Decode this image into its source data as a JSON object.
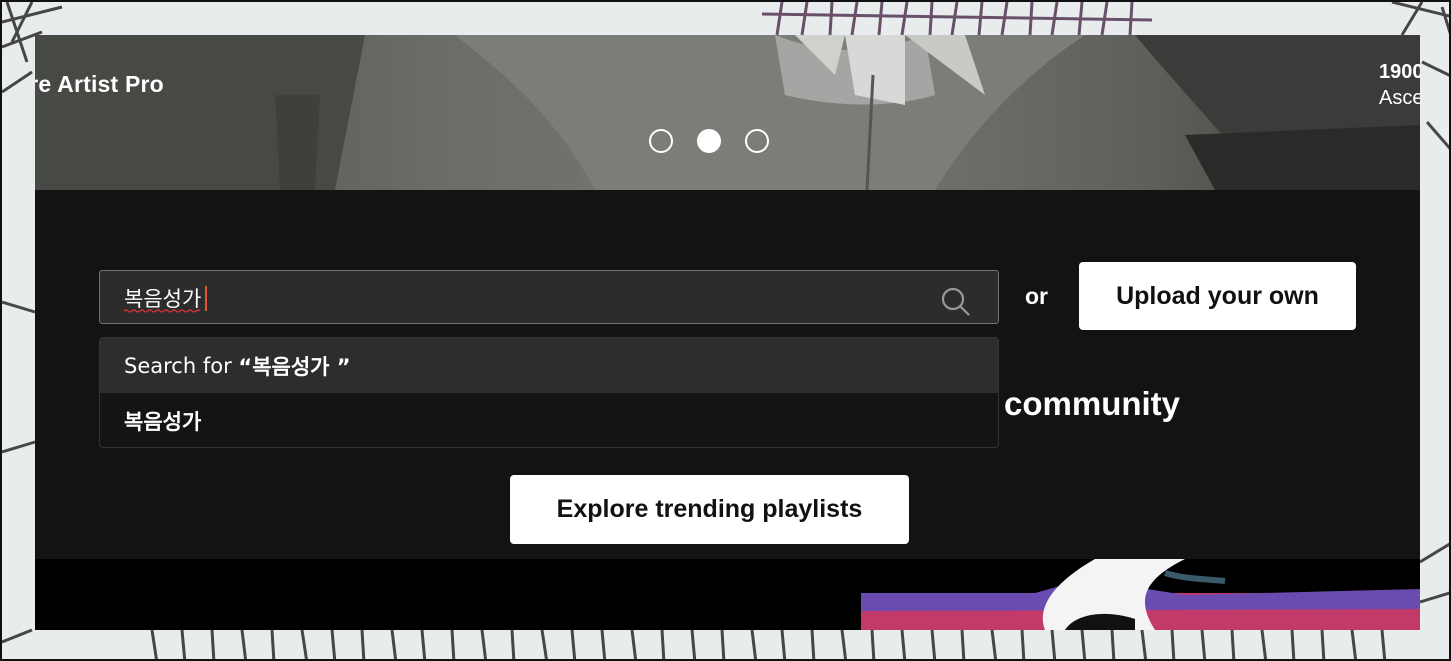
{
  "hero": {
    "title": "ore Artist Pro",
    "side_line1": "1900",
    "side_line2": "Asce",
    "carousel_dots": [
      {
        "active": false
      },
      {
        "active": true
      },
      {
        "active": false
      }
    ]
  },
  "search": {
    "value": "복음성가",
    "icon": "search-icon"
  },
  "or_label": "or",
  "upload_label": "Upload your own",
  "dropdown": {
    "search_for_prefix": "Search for ",
    "search_for_query": "“복음성가 ”",
    "suggestion": "복음성가"
  },
  "community_text": "community",
  "explore_label": "Explore trending playlists",
  "colors": {
    "panel_bg": "#131313",
    "caret": "#e0562c",
    "button_bg": "#ffffff"
  }
}
